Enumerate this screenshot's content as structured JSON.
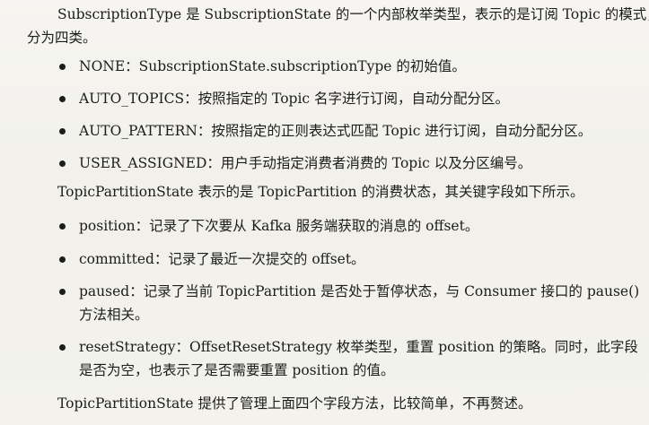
{
  "intro": {
    "line1": "SubscriptionType 是 SubscriptionState 的一个内部枚举类型，表示的是订阅 Topic 的模式，",
    "line2": "分为四类。"
  },
  "subscription_types": [
    {
      "text": "NONE：SubscriptionState.subscriptionType 的初始值。"
    },
    {
      "text": "AUTO_TOPICS：按照指定的 Topic 名字进行订阅，自动分配分区。"
    },
    {
      "text": "AUTO_PATTERN：按照指定的正则表达式匹配 Topic 进行订阅，自动分配分区。"
    },
    {
      "text": "USER_ASSIGNED：用户手动指定消费者消费的 Topic 以及分区编号。"
    }
  ],
  "partition_state_intro": "TopicPartitionState 表示的是 TopicPartition 的消费状态，其关键字段如下所示。",
  "fields": [
    {
      "line1": "position：记录了下次要从 Kafka 服务端获取的消息的 offset。",
      "line2": ""
    },
    {
      "line1": "committed：记录了最近一次提交的 offset。",
      "line2": ""
    },
    {
      "line1": "paused：记录了当前 TopicPartition 是否处于暂停状态，与 Consumer 接口的 pause()",
      "line2": "方法相关。"
    },
    {
      "line1": "resetStrategy：OffsetResetStrategy 枚举类型，重置 position 的策略。同时，此字段",
      "line2": "是否为空，也表示了是否需要重置 position 的值。"
    }
  ],
  "conclusion": "TopicPartitionState 提供了管理上面四个字段方法，比较简单，不再赘述。"
}
